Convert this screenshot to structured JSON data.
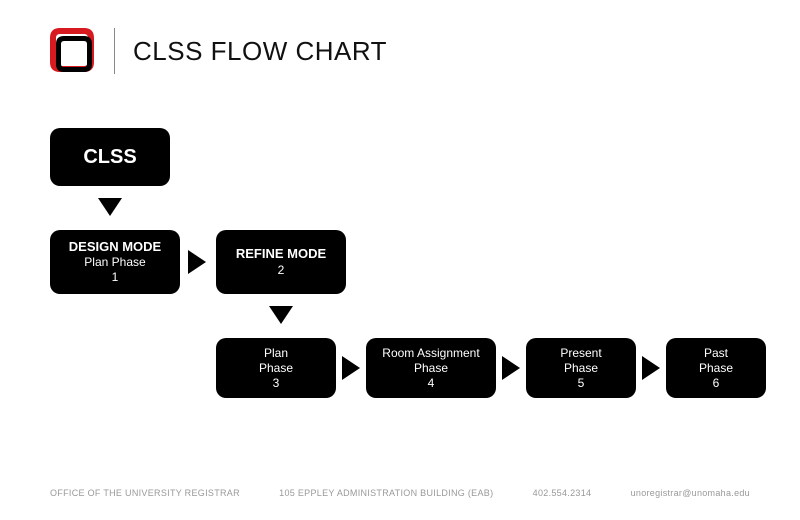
{
  "header": {
    "title": "CLSS FLOW CHART"
  },
  "flow": {
    "root": {
      "label": "CLSS"
    },
    "node1": {
      "line1": "DESIGN MODE",
      "line2": "Plan Phase",
      "line3": "1"
    },
    "node2": {
      "line1": "REFINE MODE",
      "line3": "2"
    },
    "node3": {
      "line1": "Plan",
      "line2": "Phase",
      "line3": "3"
    },
    "node4": {
      "line1": "Room Assignment",
      "line2": "Phase",
      "line3": "4"
    },
    "node5": {
      "line1": "Present",
      "line2": "Phase",
      "line3": "5"
    },
    "node6": {
      "line1": "Past",
      "line2": "Phase",
      "line3": "6"
    }
  },
  "footer": {
    "office": "OFFICE OF THE UNIVERSITY REGISTRAR",
    "address": "105 EPPLEY ADMINISTRATION BUILDING (EAB)",
    "phone": "402.554.2314",
    "email": "unoregistrar@unomaha.edu"
  }
}
